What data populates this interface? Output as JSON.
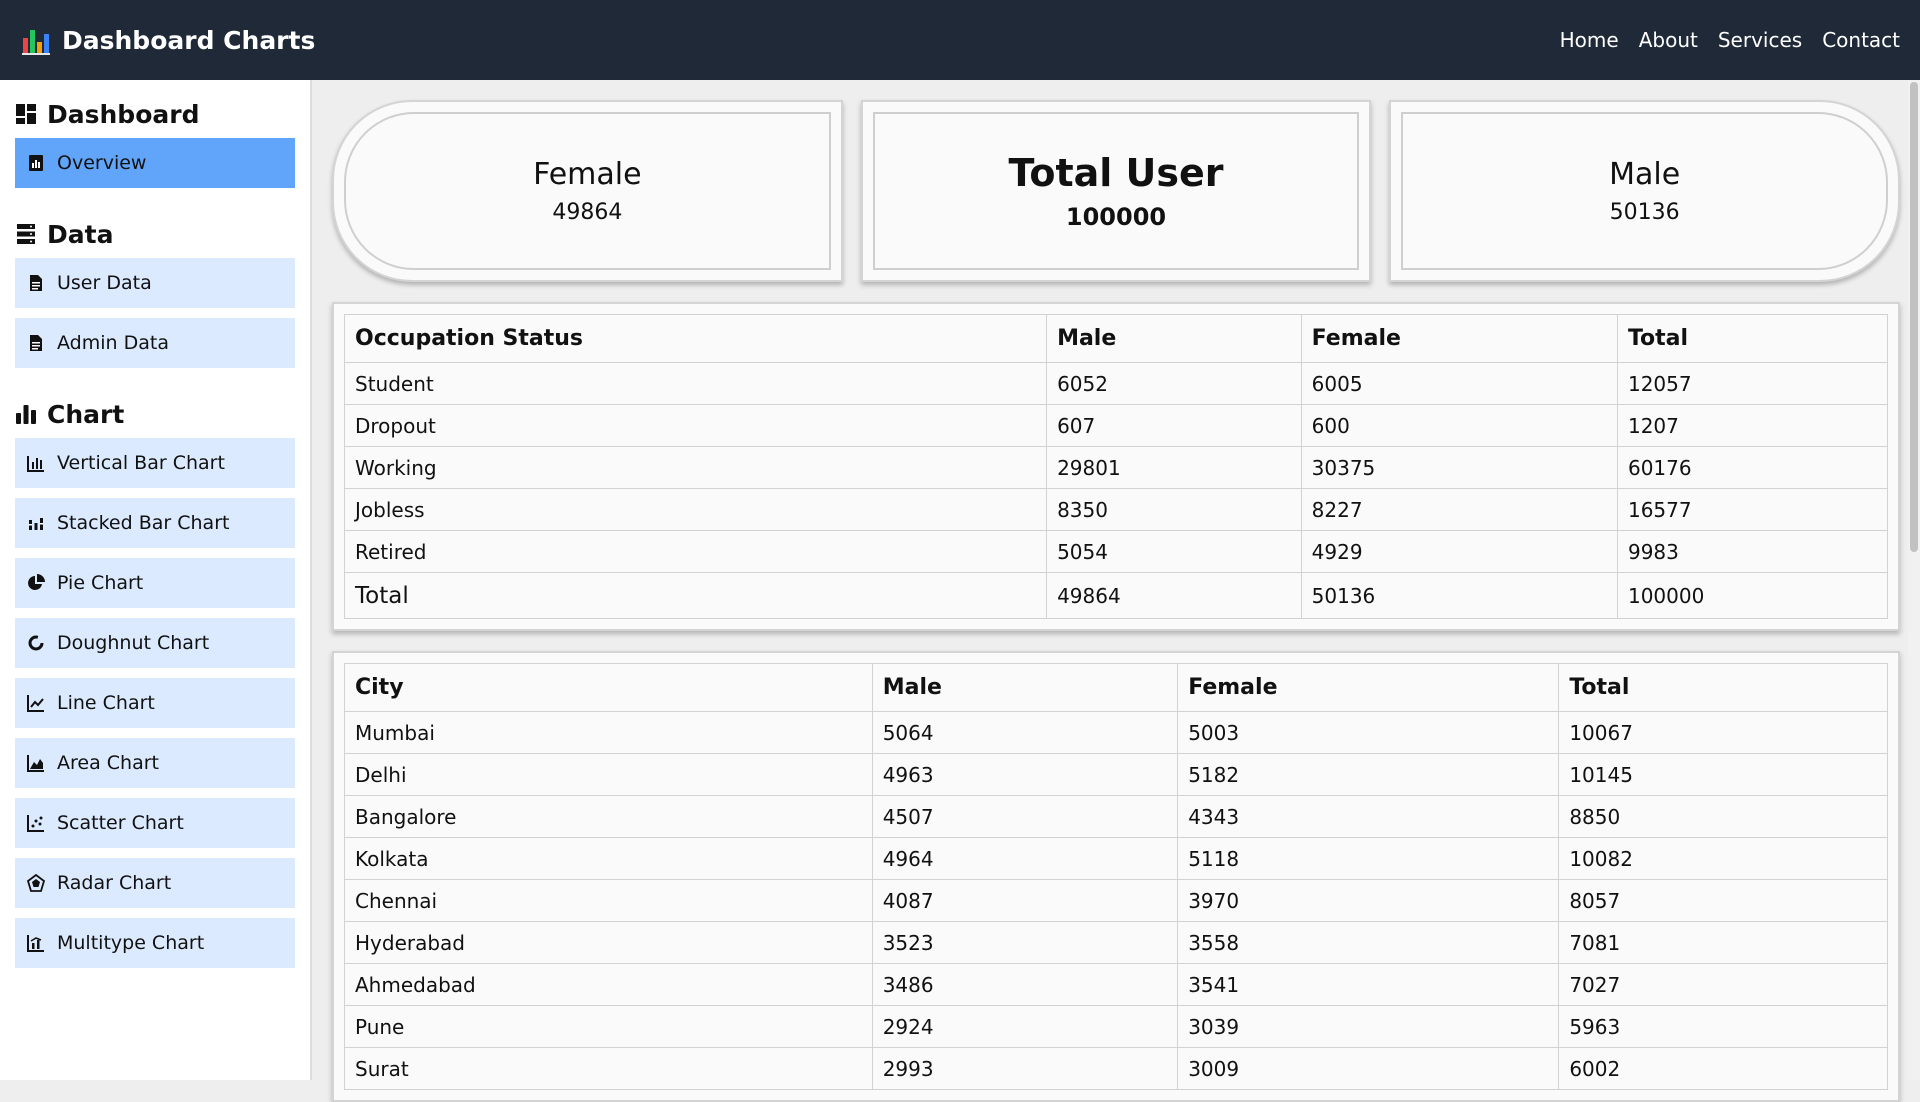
{
  "app": {
    "title": "Dashboard Charts",
    "nav": [
      "Home",
      "About",
      "Services",
      "Contact"
    ]
  },
  "sidebar": {
    "sections": [
      {
        "title": "Dashboard",
        "icon": "dashboard-grid-icon",
        "items": [
          {
            "label": "Overview",
            "icon": "overview-icon",
            "active": true
          }
        ]
      },
      {
        "title": "Data",
        "icon": "database-icon",
        "items": [
          {
            "label": "User Data",
            "icon": "document-icon"
          },
          {
            "label": "Admin Data",
            "icon": "document-icon"
          }
        ]
      },
      {
        "title": "Chart",
        "icon": "chart-bars-icon",
        "items": [
          {
            "label": "Vertical Bar Chart",
            "icon": "vertical-bar-icon"
          },
          {
            "label": "Stacked Bar Chart",
            "icon": "stacked-bar-icon"
          },
          {
            "label": "Pie Chart",
            "icon": "pie-icon"
          },
          {
            "label": "Doughnut Chart",
            "icon": "doughnut-icon"
          },
          {
            "label": "Line Chart",
            "icon": "line-icon"
          },
          {
            "label": "Area Chart",
            "icon": "area-icon"
          },
          {
            "label": "Scatter Chart",
            "icon": "scatter-icon"
          },
          {
            "label": "Radar Chart",
            "icon": "radar-icon"
          },
          {
            "label": "Multitype Chart",
            "icon": "multitype-icon"
          }
        ]
      }
    ]
  },
  "cards": {
    "female": {
      "label": "Female",
      "value": "49864"
    },
    "total": {
      "label": "Total User",
      "value": "100000"
    },
    "male": {
      "label": "Male",
      "value": "50136"
    }
  },
  "occupation": {
    "headers": [
      "Occupation Status",
      "Male",
      "Female",
      "Total"
    ],
    "rows": [
      [
        "Student",
        "6052",
        "6005",
        "12057"
      ],
      [
        "Dropout",
        "607",
        "600",
        "1207"
      ],
      [
        "Working",
        "29801",
        "30375",
        "60176"
      ],
      [
        "Jobless",
        "8350",
        "8227",
        "16577"
      ],
      [
        "Retired",
        "5054",
        "4929",
        "9983"
      ],
      [
        "Total",
        "49864",
        "50136",
        "100000"
      ]
    ]
  },
  "city": {
    "headers": [
      "City",
      "Male",
      "Female",
      "Total"
    ],
    "rows": [
      [
        "Mumbai",
        "5064",
        "5003",
        "10067"
      ],
      [
        "Delhi",
        "4963",
        "5182",
        "10145"
      ],
      [
        "Bangalore",
        "4507",
        "4343",
        "8850"
      ],
      [
        "Kolkata",
        "4964",
        "5118",
        "10082"
      ],
      [
        "Chennai",
        "4087",
        "3970",
        "8057"
      ],
      [
        "Hyderabad",
        "3523",
        "3558",
        "7081"
      ],
      [
        "Ahmedabad",
        "3486",
        "3541",
        "7027"
      ],
      [
        "Pune",
        "2924",
        "3039",
        "5963"
      ],
      [
        "Surat",
        "2993",
        "3009",
        "6002"
      ]
    ]
  },
  "colors": {
    "topbar": "#1f2937",
    "active_item": "#60a5fa",
    "item": "#dbeafe"
  }
}
